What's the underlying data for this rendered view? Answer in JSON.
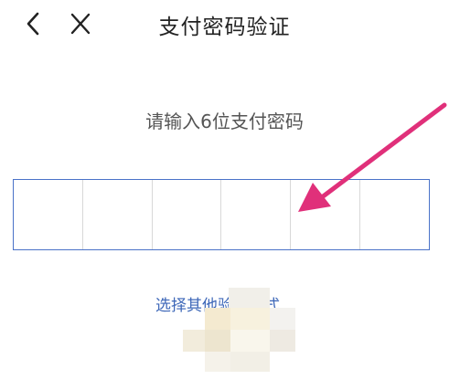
{
  "header": {
    "back_icon": "chevron-left-icon",
    "close_icon": "close-icon",
    "title": "支付密码验证"
  },
  "prompt": {
    "text": "请输入6位支付密码"
  },
  "pin": {
    "length": 6,
    "entered": 0,
    "border_color": "#4a72c8"
  },
  "alternate": {
    "label": "选择其他验证方式",
    "color": "#3d67b8"
  },
  "annotation": {
    "arrow_color": "#e0307a"
  }
}
